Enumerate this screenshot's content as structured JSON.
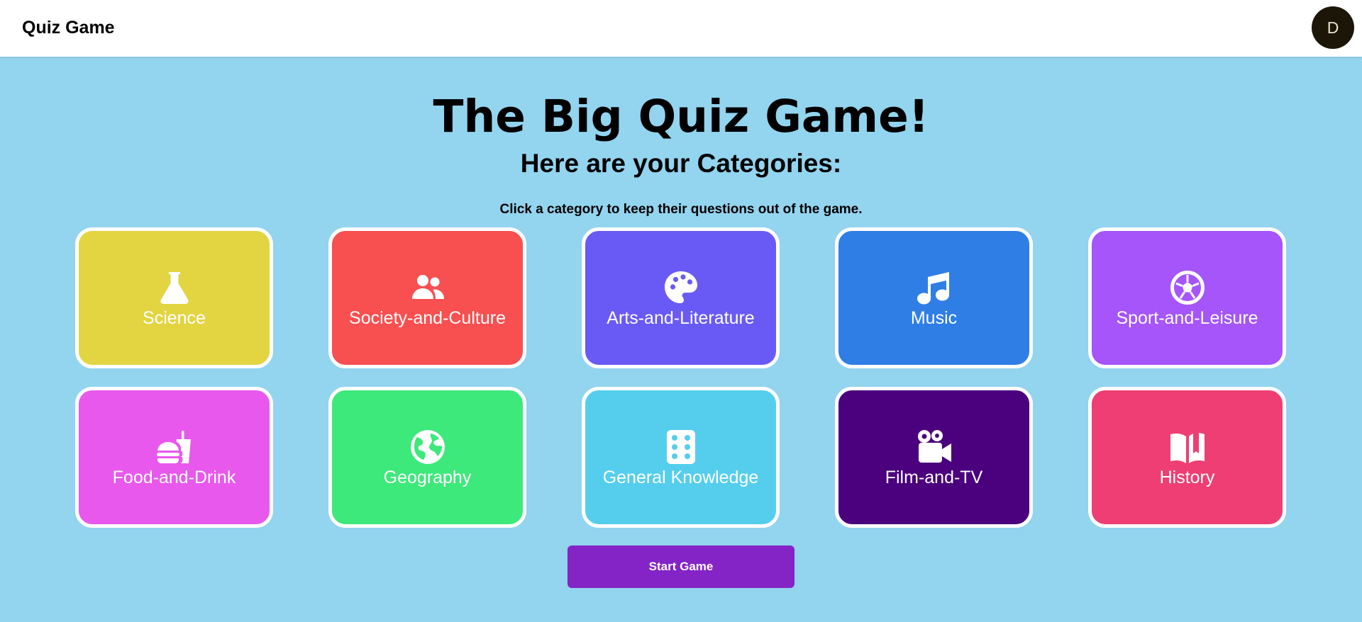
{
  "header": {
    "app_title": "Quiz Game",
    "avatar_initial": "D"
  },
  "main": {
    "title": "The Big Quiz Game!",
    "subtitle": "Here are your Categories:",
    "instruction": "Click a category to keep their questions out of the game.",
    "categories": [
      {
        "label": "Science",
        "icon": "flask-icon",
        "color": "#e3d442"
      },
      {
        "label": "Society-and-Culture",
        "icon": "users-icon",
        "color": "#f84f50"
      },
      {
        "label": "Arts-and-Literature",
        "icon": "palette-icon",
        "color": "#6a5af5"
      },
      {
        "label": "Music",
        "icon": "music-note-icon",
        "color": "#2f7ee6"
      },
      {
        "label": "Sport-and-Leisure",
        "icon": "soccer-ball-icon",
        "color": "#a555fa"
      },
      {
        "label": "Food-and-Drink",
        "icon": "burger-drink-icon",
        "color": "#e858ec"
      },
      {
        "label": "Geography",
        "icon": "globe-icon",
        "color": "#3de97a"
      },
      {
        "label": "General Knowledge",
        "icon": "dice-icon",
        "color": "#55ceed"
      },
      {
        "label": "Film-and-TV",
        "icon": "video-camera-icon",
        "color": "#4b007e"
      },
      {
        "label": "History",
        "icon": "open-book-icon",
        "color": "#ee3e73"
      }
    ],
    "start_button_label": "Start Game"
  },
  "colors": {
    "background": "#93d4ef",
    "start_button": "#8524c6",
    "card_border": "#ffffff"
  }
}
